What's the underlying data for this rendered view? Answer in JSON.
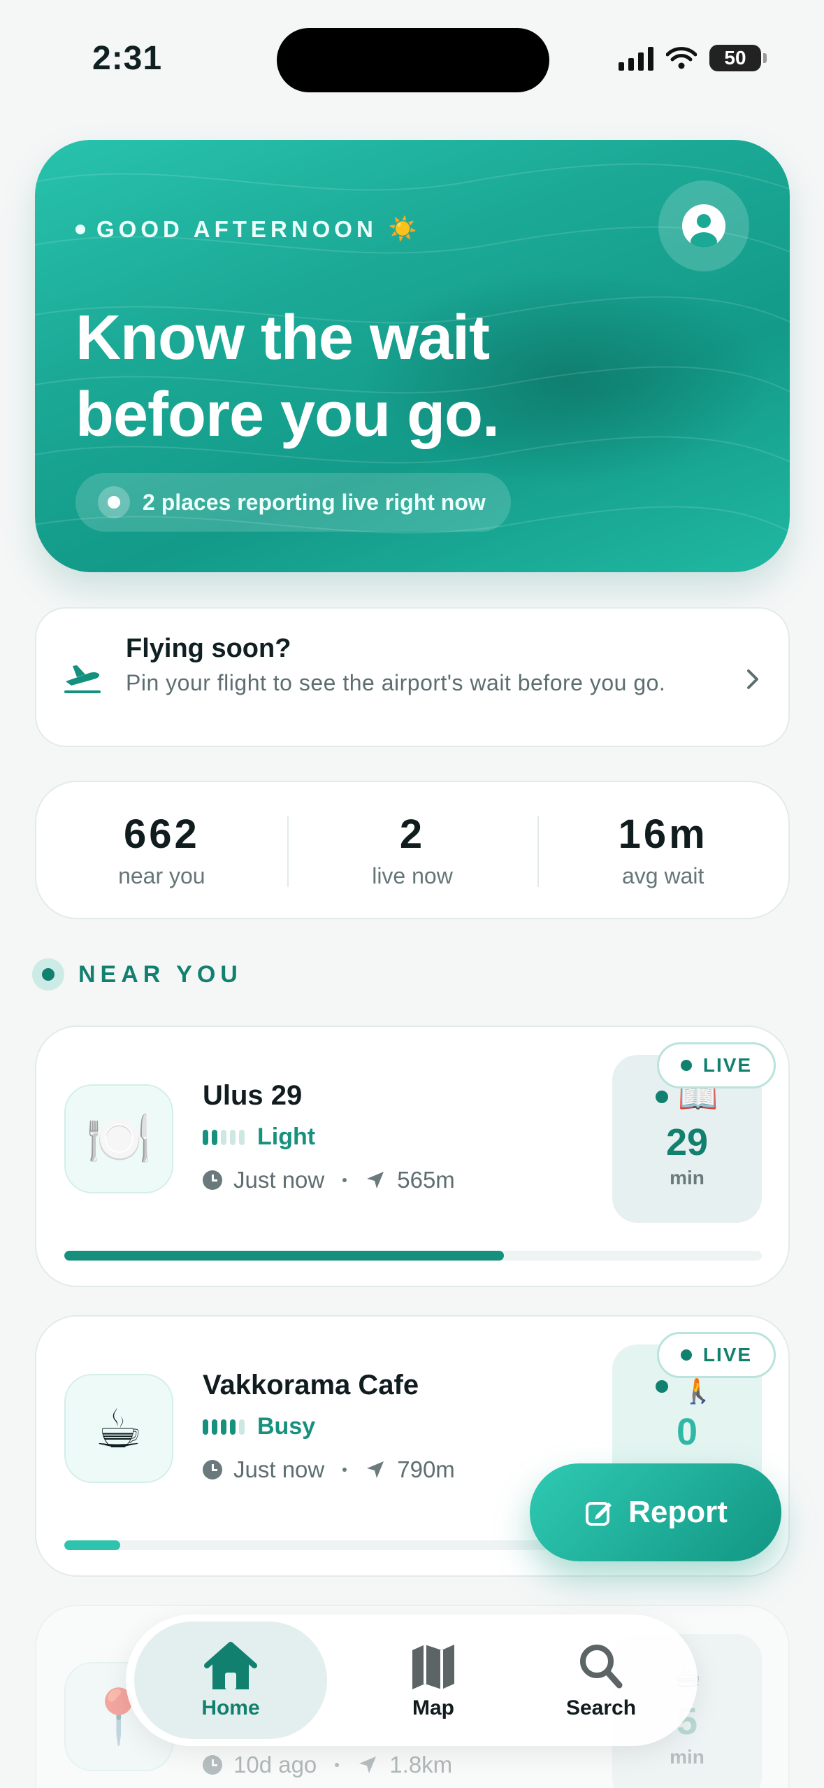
{
  "status": {
    "time": "2:31",
    "battery": "50"
  },
  "hero": {
    "greeting": "GOOD AFTERNOON",
    "greeting_emoji": "☀️",
    "title": "Know the wait before you go.",
    "live_text": "2 places reporting live right now",
    "avatar_icon": "user-avatar-icon"
  },
  "flight": {
    "title": "Flying soon?",
    "subtitle": "Pin your flight to see the airport's wait before you go.",
    "icon": "airplane-takeoff-icon"
  },
  "stats": [
    {
      "value": "662",
      "label": "near you"
    },
    {
      "value": "2",
      "label": "live now"
    },
    {
      "value": "16m",
      "label": "avg wait"
    }
  ],
  "section": {
    "title": "NEAR YOU"
  },
  "places": [
    {
      "name": "Ulus 29",
      "emoji": "🍽️",
      "busy": "Light",
      "bars_on": 2,
      "time": "Just now",
      "distance": "565m",
      "wait_emoji": "📖",
      "wait": "29",
      "unit": "min",
      "live": "LIVE",
      "progress": 0.63
    },
    {
      "name": "Vakkorama Cafe",
      "emoji": "☕",
      "busy": "Busy",
      "bars_on": 4,
      "time": "Just now",
      "distance": "790m",
      "wait_emoji": "🚶",
      "wait": "0",
      "unit": "",
      "live": "LIVE",
      "progress": 0.08
    },
    {
      "name": "",
      "emoji": "📍",
      "busy": "",
      "bars_on": 0,
      "time": "10d ago",
      "distance": "1.8km",
      "wait_emoji": "☕",
      "wait": "5",
      "unit": "min",
      "live": "",
      "progress": 0
    }
  ],
  "fab": {
    "label": "Report",
    "icon": "edit-icon"
  },
  "tabs": [
    {
      "label": "Home",
      "icon": "home-icon"
    },
    {
      "label": "Map",
      "icon": "map-icon"
    },
    {
      "label": "Search",
      "icon": "search-icon"
    }
  ],
  "colors": {
    "accent": "#12806f",
    "hero": "#1ba996"
  }
}
